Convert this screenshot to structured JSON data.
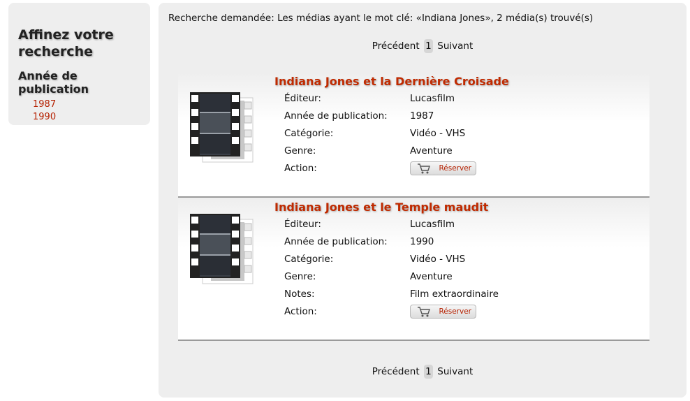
{
  "sidebar": {
    "title": "Affinez votre recherche",
    "facet_title": "Année de publication",
    "years": [
      "1987",
      "1990"
    ]
  },
  "search": {
    "summary": "Recherche demandée: Les médias ayant le mot clé: «Indiana Jones», 2 média(s) trouvé(s)"
  },
  "pager": {
    "prev": "Précédent",
    "current": "1",
    "next": "Suivant"
  },
  "results": [
    {
      "title": "Indiana Jones et la Dernière Croisade",
      "thumb_icon": "film-strip-icon",
      "fields": [
        {
          "label": "Éditeur:",
          "value": "Lucasfilm"
        },
        {
          "label": "Année de publication:",
          "value": "1987"
        },
        {
          "label": "Catégorie:",
          "value": "Vidéo - VHS"
        },
        {
          "label": "Genre:",
          "value": "Aventure"
        }
      ],
      "action_label": "Action:",
      "reserve_label": "Réserver"
    },
    {
      "title": "Indiana Jones et le Temple maudit",
      "thumb_icon": "film-strip-icon",
      "fields": [
        {
          "label": "Éditeur:",
          "value": "Lucasfilm"
        },
        {
          "label": "Année de publication:",
          "value": "1990"
        },
        {
          "label": "Catégorie:",
          "value": "Vidéo - VHS"
        },
        {
          "label": "Genre:",
          "value": "Aventure"
        },
        {
          "label": "Notes:",
          "value": "Film extraordinaire"
        }
      ],
      "action_label": "Action:",
      "reserve_label": "Réserver"
    }
  ],
  "colors": {
    "accent": "#c02a00",
    "panel": "#eeeeee",
    "divider": "#9a9a9a"
  }
}
